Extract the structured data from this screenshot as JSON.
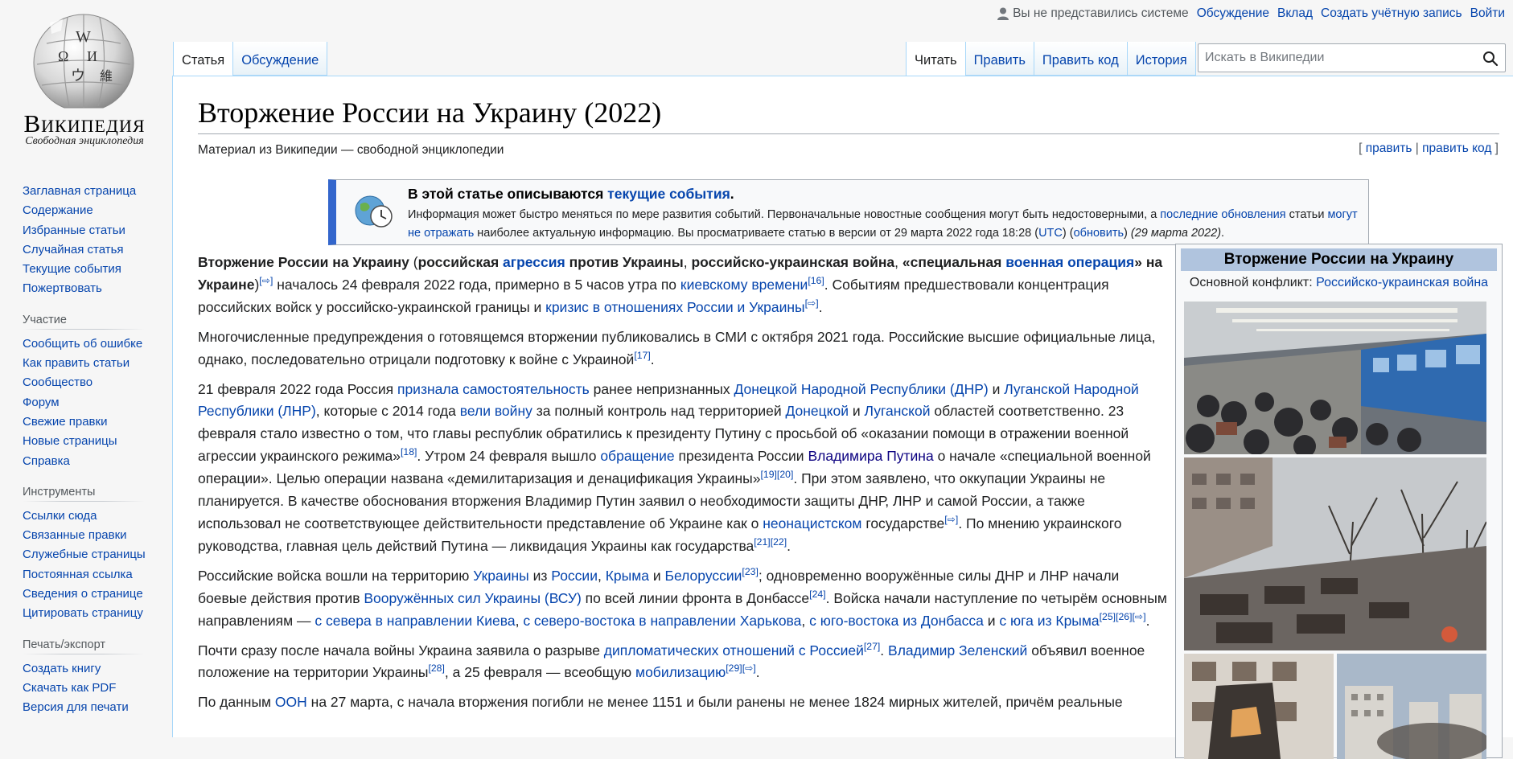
{
  "logo": {
    "wordmark": "Википедия",
    "tagline": "Свободная энциклопедия"
  },
  "personal": {
    "not_logged_in": "Вы не представились системе",
    "talk": "Обсуждение",
    "contributions": "Вклад",
    "create_account": "Создать учётную запись",
    "login": "Войти"
  },
  "tabs_left": [
    {
      "label": "Статья"
    },
    {
      "label": "Обсуждение"
    }
  ],
  "tabs_right": [
    {
      "label": "Читать"
    },
    {
      "label": "Править"
    },
    {
      "label": "Править код"
    },
    {
      "label": "История"
    }
  ],
  "search": {
    "placeholder": "Искать в Википедии"
  },
  "sidebar": {
    "nav": [
      "Заглавная страница",
      "Содержание",
      "Избранные статьи",
      "Случайная статья",
      "Текущие события",
      "Пожертвовать"
    ],
    "participation_head": "Участие",
    "participation": [
      "Сообщить об ошибке",
      "Как править статьи",
      "Сообщество",
      "Форум",
      "Свежие правки",
      "Новые страницы",
      "Справка"
    ],
    "tools_head": "Инструменты",
    "tools": [
      "Ссылки сюда",
      "Связанные правки",
      "Служебные страницы",
      "Постоянная ссылка",
      "Сведения о странице",
      "Цитировать страницу"
    ],
    "print_head": "Печать/экспорт",
    "print": [
      "Создать книгу",
      "Скачать как PDF",
      "Версия для печати"
    ]
  },
  "article": {
    "title": "Вторжение России на Украину (2022)",
    "site_sub": "Материал из Википедии — свободной энциклопедии",
    "edit_open": "[ ",
    "edit": "править",
    "edit_sep": " | ",
    "edit_code": "править код",
    "edit_close": " ]"
  },
  "notice": {
    "title_pre": "В этой статье описываются ",
    "title_link": "текущие события",
    "title_post": ".",
    "t1": "Информация может быстро меняться по мере развития событий. Первоначальные новостные сообщения могут быть недостоверными, а ",
    "l1": "последние обновления",
    "t2": " статьи ",
    "l2": "могут не отражать",
    "t3": " наиболее актуальную информацию. Вы просматриваете статью в версии от 29 марта 2022 года 18:28 (",
    "l3": "UTC",
    "t4": ") (",
    "l4": "обновить",
    "t5": ") ",
    "date_italic": "(29 марта 2022)",
    "t6": "."
  },
  "infobox": {
    "title": "Вторжение России на Украину",
    "sub_label": "Основной конфликт: ",
    "sub_link": "Российско-украинская война"
  },
  "paragraphs": [
    [
      {
        "b": "Вторжение России на Украину"
      },
      {
        "t": " ("
      },
      {
        "b": "российская "
      },
      {
        "a": "агрессия",
        "bold": true
      },
      {
        "b": " против Украины"
      },
      {
        "t": ", "
      },
      {
        "b": "российско-украинская война"
      },
      {
        "t": ", "
      },
      {
        "b": "«специальная "
      },
      {
        "a": "военная операция",
        "bold": true
      },
      {
        "b": "» на Украине"
      },
      {
        "t": ")"
      },
      {
        "s": "[⇨]"
      },
      {
        "t": " началось 24 февраля 2022 года, примерно в 5 часов утра по "
      },
      {
        "a": "киевскому времени"
      },
      {
        "s": "[16]"
      },
      {
        "t": ". Событиям предшествовали концентрация российских войск у российско-украинской границы и "
      },
      {
        "a": "кризис в отношениях России и Украины"
      },
      {
        "s": "[⇨]"
      },
      {
        "t": "."
      }
    ],
    [
      {
        "t": "Многочисленные предупреждения о готовящемся вторжении публиковались в СМИ с октября 2021 года. Российские высшие официальные лица, однако, последовательно отрицали подготовку к войне с Украиной"
      },
      {
        "s": "[17]"
      },
      {
        "t": "."
      }
    ],
    [
      {
        "t": "21 февраля 2022 года Россия "
      },
      {
        "a": "признала самостоятельность"
      },
      {
        "t": " ранее непризнанных "
      },
      {
        "a": "Донецкой Народной Республики (ДНР)"
      },
      {
        "t": " и "
      },
      {
        "a": "Луганской Народной Республики (ЛНР)"
      },
      {
        "t": ", которые с 2014 года "
      },
      {
        "a": "вели войну"
      },
      {
        "t": " за полный контроль над территорией "
      },
      {
        "a": "Донецкой"
      },
      {
        "t": " и "
      },
      {
        "a": "Луганской"
      },
      {
        "t": " областей соответственно. 23 февраля стало известно о том, что главы республик обратились к президенту Путину с просьбой об «оказании помощи в отражении военной агрессии украинского режима»"
      },
      {
        "s": "[18]"
      },
      {
        "t": ". Утром 24 февраля вышло "
      },
      {
        "a": "обращение"
      },
      {
        "t": " президента России "
      },
      {
        "a": "Владимира Путина",
        "dark": true
      },
      {
        "t": " о начале «специальной военной операции». Целью операции названа «демилитаризация и денацификация Украины»"
      },
      {
        "s": "[19][20]"
      },
      {
        "t": ". При этом заявлено, что оккупации Украины не планируется. В качестве обоснования вторжения Владимир Путин заявил о необходимости защиты ДНР, ЛНР и самой России, а также использовал не соответствующее действительности представление об Украине как о "
      },
      {
        "a": "неонацистском"
      },
      {
        "t": " государстве"
      },
      {
        "s": "[⇨]"
      },
      {
        "t": ". По мнению украинского руководства, главная цель действий Путина — ликвидация Украины как государства"
      },
      {
        "s": "[21][22]"
      },
      {
        "t": "."
      }
    ],
    [
      {
        "t": "Российские войска вошли на территорию "
      },
      {
        "a": "Украины"
      },
      {
        "t": " из "
      },
      {
        "a": "России"
      },
      {
        "t": ", "
      },
      {
        "a": "Крыма"
      },
      {
        "t": " и "
      },
      {
        "a": "Белоруссии"
      },
      {
        "s": "[23]"
      },
      {
        "t": "; одновременно вооружённые силы ДНР и ЛНР начали боевые действия против "
      },
      {
        "a": "Вооружённых сил Украины (ВСУ)"
      },
      {
        "t": " по всей линии фронта в Донбассе"
      },
      {
        "s": "[24]"
      },
      {
        "t": ". Войска начали наступление по четырём основным направлениям — "
      },
      {
        "a": "с севера в направлении Киева"
      },
      {
        "t": ", "
      },
      {
        "a": "с северо-востока в направлении Харькова"
      },
      {
        "t": ", "
      },
      {
        "a": "с юго-востока из Донбасса"
      },
      {
        "t": " и "
      },
      {
        "a": "с юга из Крыма"
      },
      {
        "s": "[25][26][⇨]"
      },
      {
        "t": "."
      }
    ],
    [
      {
        "t": "Почти сразу после начала войны Украина заявила о разрыве "
      },
      {
        "a": "дипломатических отношений с Россией"
      },
      {
        "s": "[27]"
      },
      {
        "t": ". "
      },
      {
        "a": "Владимир Зеленский"
      },
      {
        "t": " объявил военное положение на территории Украины"
      },
      {
        "s": "[28]"
      },
      {
        "t": ", а 25 февраля — всеобщую "
      },
      {
        "a": "мобилизацию"
      },
      {
        "s": "[29][⇨]"
      },
      {
        "t": "."
      }
    ],
    [
      {
        "t": "По данным "
      },
      {
        "a": "ООН"
      },
      {
        "t": " на 27 марта, с начала вторжения погибли не менее 1151 и были ранены не менее 1824 мирных жителей, причём реальные"
      }
    ]
  ]
}
